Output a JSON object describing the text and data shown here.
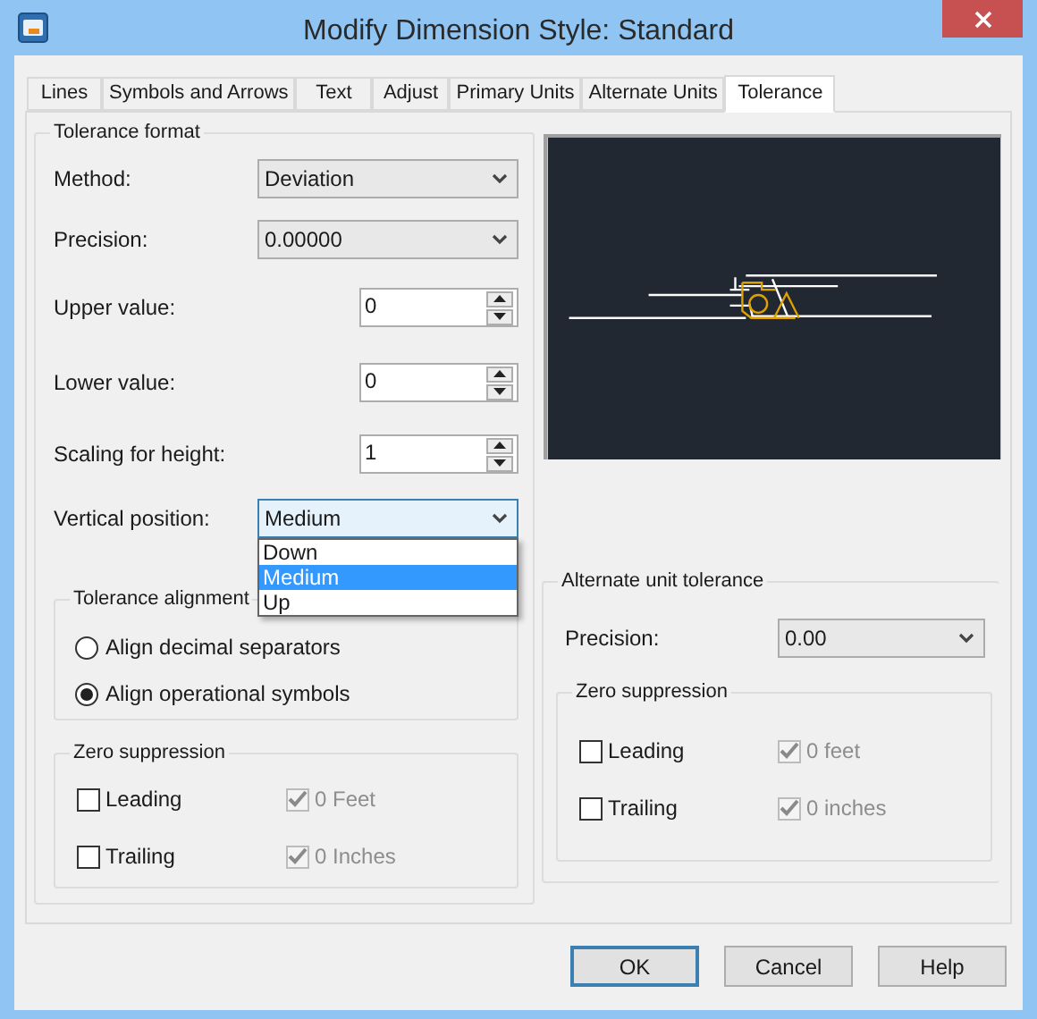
{
  "window": {
    "title": "Modify Dimension Style: Standard"
  },
  "tabs": [
    {
      "label": "Lines",
      "selected": false
    },
    {
      "label": "Symbols and Arrows",
      "selected": false
    },
    {
      "label": "Text",
      "selected": false
    },
    {
      "label": "Adjust",
      "selected": false
    },
    {
      "label": "Primary Units",
      "selected": false
    },
    {
      "label": "Alternate Units",
      "selected": false
    },
    {
      "label": "Tolerance",
      "selected": true
    }
  ],
  "tolerance_format": {
    "title": "Tolerance format",
    "fields": [
      {
        "kind": "dropdown",
        "label": "Method:",
        "value": "Deviation"
      },
      {
        "kind": "dropdown",
        "label": "Precision:",
        "value": "0.00000"
      },
      {
        "kind": "spin",
        "label": "Upper value:",
        "value": "0"
      },
      {
        "kind": "spin",
        "label": "Lower value:",
        "value": "0"
      },
      {
        "kind": "spin",
        "label": "Scaling for height:",
        "value": "1"
      },
      {
        "kind": "dropdown",
        "label": "Vertical position:",
        "value": "Medium",
        "expanded": true,
        "options": [
          {
            "label": "Down",
            "selected": false
          },
          {
            "label": "Medium",
            "selected": true
          },
          {
            "label": "Up",
            "selected": false
          }
        ]
      }
    ],
    "tolerance_alignment": {
      "title": "Tolerance alignment",
      "options": [
        {
          "label": "Align decimal separators",
          "selected": false
        },
        {
          "label": "Align operational symbols",
          "selected": true
        }
      ]
    },
    "zero_suppression": {
      "title": "Zero suppression",
      "rows": [
        [
          {
            "label": "Leading",
            "checked": false,
            "disabled": false
          },
          {
            "label": "0 Feet",
            "checked": true,
            "disabled": true
          }
        ],
        [
          {
            "label": "Trailing",
            "checked": false,
            "disabled": false
          },
          {
            "label": "0 Inches",
            "checked": true,
            "disabled": true
          }
        ]
      ]
    }
  },
  "alternate_unit_tolerance": {
    "title": "Alternate unit tolerance",
    "precision": {
      "label": "Precision:",
      "value": "0.00"
    },
    "zero_suppression": {
      "title": "Zero suppression",
      "rows": [
        [
          {
            "label": "Leading",
            "checked": false,
            "disabled": false
          },
          {
            "label": "0 feet",
            "checked": true,
            "disabled": true
          }
        ],
        [
          {
            "label": "Trailing",
            "checked": false,
            "disabled": false
          },
          {
            "label": "0 inches",
            "checked": true,
            "disabled": true
          }
        ]
      ]
    }
  },
  "buttons": [
    {
      "label": "OK",
      "default": true
    },
    {
      "label": "Cancel",
      "default": false
    },
    {
      "label": "Help",
      "default": false
    }
  ]
}
